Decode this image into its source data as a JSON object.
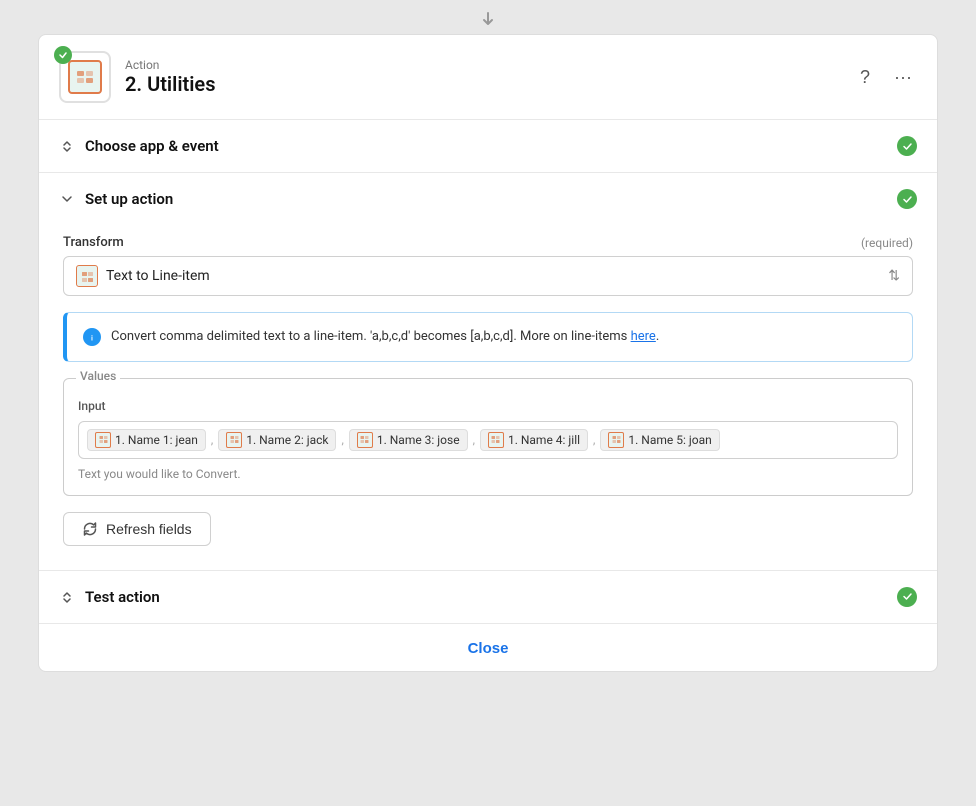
{
  "page": {
    "arrow_down": "▼"
  },
  "header": {
    "action_label": "Action",
    "action_title": "2. Utilities",
    "help_label": "?",
    "more_label": "···"
  },
  "choose_app_section": {
    "title": "Choose app & event",
    "collapsed": true
  },
  "setup_action_section": {
    "title": "Set up action",
    "collapsed": false,
    "transform_field": {
      "label": "Transform",
      "required_label": "(required)",
      "value": "Text to Line-item"
    },
    "info_box": {
      "text": "Convert comma delimited text to a line-item. 'a,b,c,d' becomes [a,b,c,d]. More on line-items ",
      "link_text": "here",
      "link_suffix": "."
    },
    "values_group": {
      "legend": "Values",
      "input_label": "Input",
      "tags": [
        {
          "label": "1. Name 1: jean"
        },
        {
          "label": "1. Name 2: jack"
        },
        {
          "label": "1. Name 3: jose"
        },
        {
          "label": "1. Name 4: jill"
        },
        {
          "label": "1. Name 5: joan"
        }
      ],
      "helper_text": "Text you would like to Convert."
    },
    "refresh_button": "Refresh fields"
  },
  "test_action_section": {
    "title": "Test action",
    "collapsed": true
  },
  "close_button": "Close"
}
